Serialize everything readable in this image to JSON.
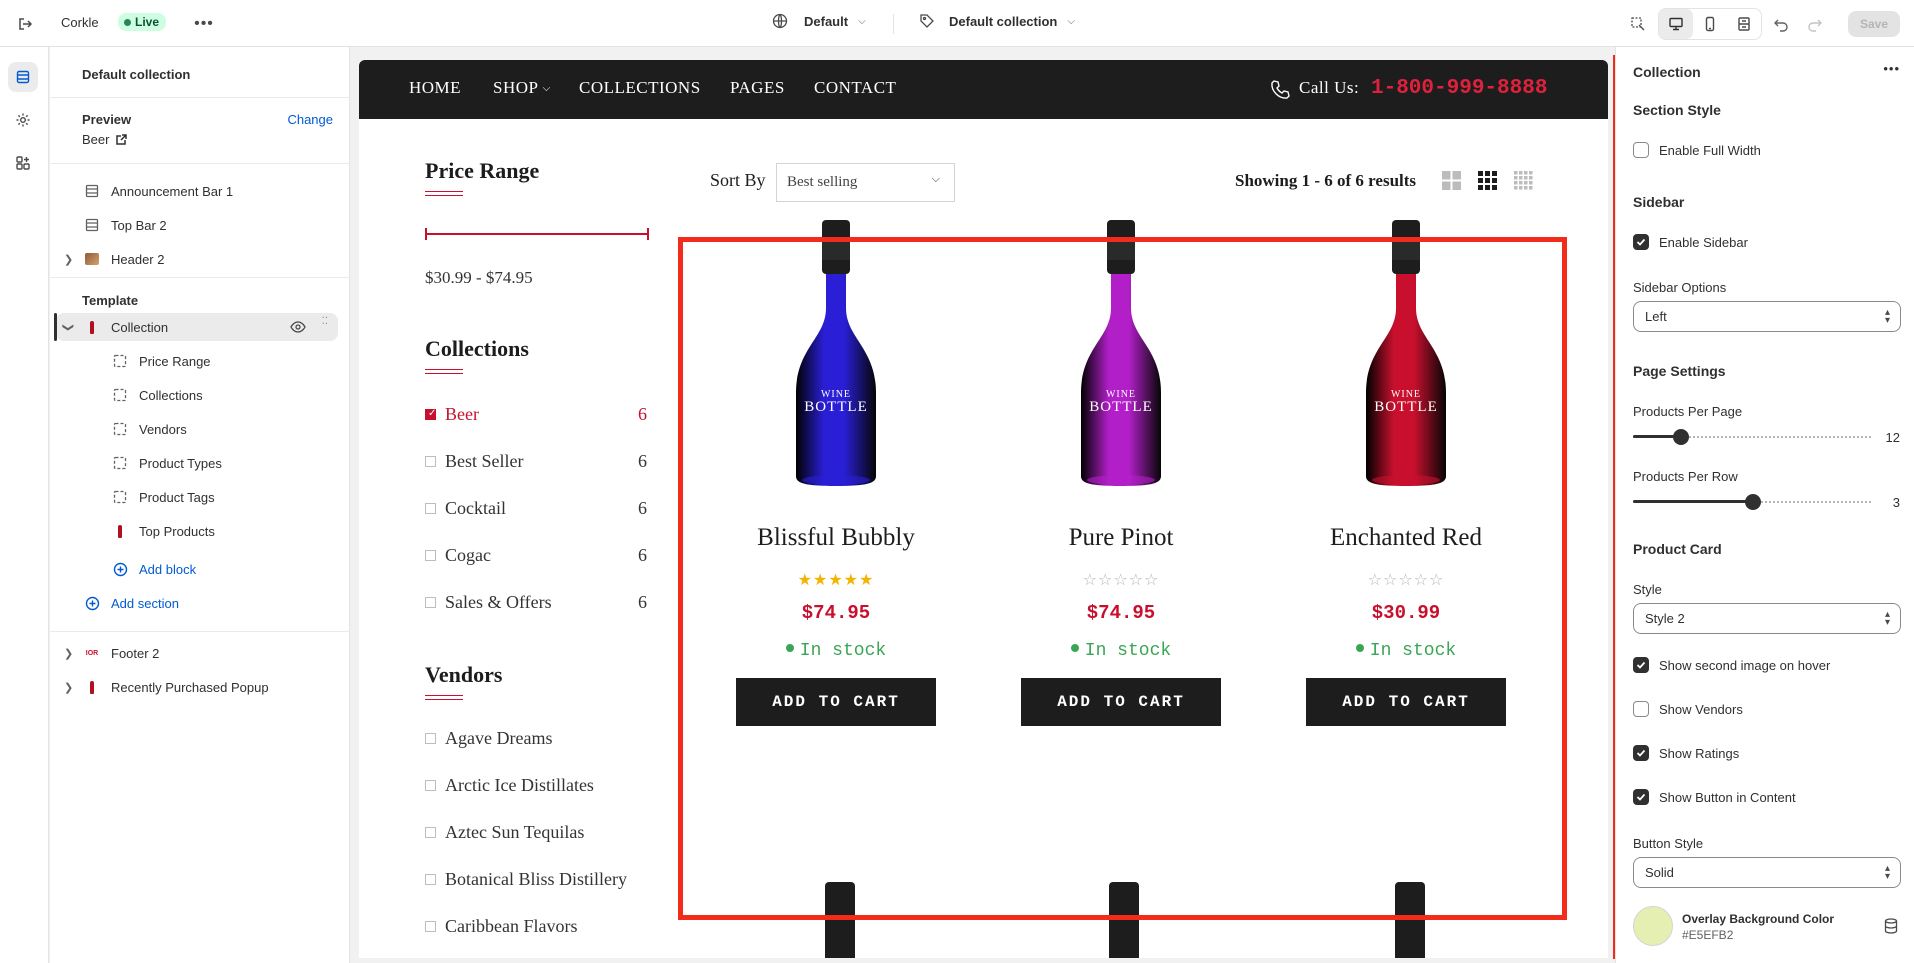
{
  "topbar": {
    "store_name": "Corkle",
    "status": "Live",
    "theme_label": "Default",
    "template_label": "Default collection",
    "save_label": "Save"
  },
  "left_panel": {
    "title": "Default collection",
    "preview_label": "Preview",
    "change_label": "Change",
    "preview_value": "Beer",
    "header_sections": [
      {
        "label": "Announcement Bar 1",
        "icon": "section-icon"
      },
      {
        "label": "Top Bar 2",
        "icon": "section-icon"
      },
      {
        "label": "Header 2",
        "icon": "image-thumb-icon"
      }
    ],
    "template_label": "Template",
    "template_section": "Collection",
    "blocks": [
      "Price Range",
      "Collections",
      "Vendors",
      "Product Types",
      "Product Tags",
      "Top Products"
    ],
    "add_block_label": "Add block",
    "add_section_label": "Add section",
    "footer_sections": [
      {
        "label": "Footer 2",
        "icon": "logo-thumb-icon"
      },
      {
        "label": "Recently Purchased Popup",
        "icon": "bottle-thumb-icon"
      }
    ]
  },
  "storefront": {
    "nav": [
      "HOME",
      "SHOP",
      "COLLECTIONS",
      "PAGES",
      "CONTACT"
    ],
    "call_label": "Call Us:",
    "phone": "1-800-999-8888",
    "price_range": {
      "heading": "Price Range",
      "value": "$30.99 - $74.95"
    },
    "collections": {
      "heading": "Collections",
      "items": [
        {
          "label": "Beer",
          "count": "6",
          "checked": true
        },
        {
          "label": "Best Seller",
          "count": "6",
          "checked": false
        },
        {
          "label": "Cocktail",
          "count": "6",
          "checked": false
        },
        {
          "label": "Cogac",
          "count": "6",
          "checked": false
        },
        {
          "label": "Sales & Offers",
          "count": "6",
          "checked": false
        }
      ]
    },
    "vendors": {
      "heading": "Vendors",
      "items": [
        "Agave Dreams",
        "Arctic Ice Distillates",
        "Aztec Sun Tequilas",
        "Botanical Bliss Distillery",
        "Caribbean Flavors"
      ]
    },
    "sort_label": "Sort By",
    "sort_value": "Best selling",
    "results_text": "Showing 1 - 6 of 6 results",
    "bottle_text": [
      "WINE",
      "BOTTLE"
    ],
    "products": [
      {
        "name": "Blissful Bubbly",
        "price": "$74.95",
        "stock": "In stock",
        "rating": 5,
        "color": "#2a1fd6"
      },
      {
        "name": "Pure Pinot",
        "price": "$74.95",
        "stock": "In stock",
        "rating": 0,
        "color": "#b21fc8"
      },
      {
        "name": "Enchanted Red",
        "price": "$30.99",
        "stock": "In stock",
        "rating": 0,
        "color": "#c8102e"
      }
    ],
    "add_to_cart_label": "ADD TO CART"
  },
  "right_panel": {
    "title": "Collection",
    "section_style": {
      "heading": "Section Style",
      "enable_full_width": {
        "label": "Enable Full Width",
        "checked": false
      }
    },
    "sidebar": {
      "heading": "Sidebar",
      "enable_sidebar": {
        "label": "Enable Sidebar",
        "checked": true
      },
      "options_label": "Sidebar Options",
      "options_value": "Left"
    },
    "page_settings": {
      "heading": "Page Settings",
      "per_page": {
        "label": "Products Per Page",
        "value": "12",
        "fraction": 0.2
      },
      "per_row": {
        "label": "Products Per Row",
        "value": "3",
        "fraction": 0.5
      }
    },
    "product_card": {
      "heading": "Product Card",
      "style_label": "Style",
      "style_value": "Style 2",
      "options": [
        {
          "label": "Show second image on hover",
          "checked": true
        },
        {
          "label": "Show Vendors",
          "checked": false
        },
        {
          "label": "Show Ratings",
          "checked": true
        },
        {
          "label": "Show Button in Content",
          "checked": true
        }
      ],
      "button_style_label": "Button Style",
      "button_style_value": "Solid",
      "overlay_label": "Overlay Background Color",
      "overlay_value": "#E5EFB2"
    }
  },
  "colors": {
    "accent_red": "#c8102e",
    "highlight": "#f22b1b",
    "link": "#005bd3",
    "live_bg": "#cdfee1"
  }
}
